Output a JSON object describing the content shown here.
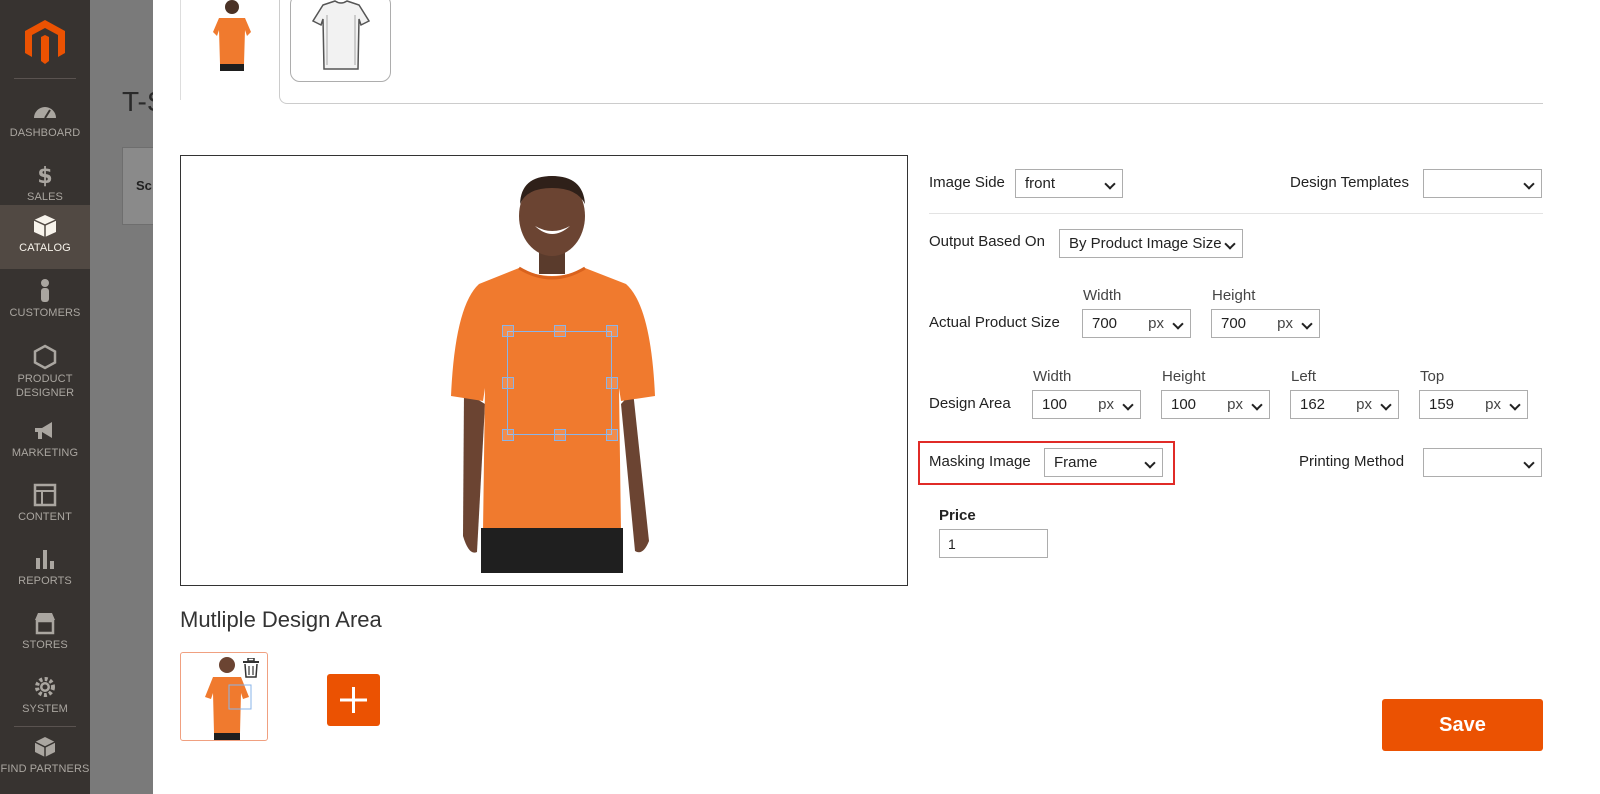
{
  "sidebar": {
    "items": [
      {
        "label": "DASHBOARD",
        "icon": "dashboard-icon"
      },
      {
        "label": "SALES",
        "icon": "dollar-icon"
      },
      {
        "label": "CATALOG",
        "icon": "box-icon",
        "active": true
      },
      {
        "label": "CUSTOMERS",
        "icon": "person-icon"
      },
      {
        "label": "PRODUCT",
        "label2": "DESIGNER",
        "icon": "hexagon-icon"
      },
      {
        "label": "MARKETING",
        "icon": "megaphone-icon"
      },
      {
        "label": "CONTENT",
        "icon": "layout-icon"
      },
      {
        "label": "REPORTS",
        "icon": "bar-chart-icon"
      },
      {
        "label": "STORES",
        "icon": "store-icon"
      },
      {
        "label": "SYSTEM",
        "icon": "gear-icon"
      },
      {
        "label": "FIND PARTNERS",
        "icon": "blocks-icon"
      }
    ]
  },
  "background": {
    "title": "T-S",
    "card_text": "Sc"
  },
  "form": {
    "image_side": {
      "label": "Image Side",
      "value": "front"
    },
    "design_templates": {
      "label": "Design Templates",
      "value": ""
    },
    "output_based_on": {
      "label": "Output Based On",
      "value": "By Product Image Size"
    },
    "actual_product_size": {
      "label": "Actual Product Size",
      "width_label": "Width",
      "width_value": "700",
      "width_unit": "px",
      "height_label": "Height",
      "height_value": "700",
      "height_unit": "px"
    },
    "design_area": {
      "label": "Design Area",
      "width_label": "Width",
      "width_value": "100",
      "width_unit": "px",
      "height_label": "Height",
      "height_value": "100",
      "height_unit": "px",
      "left_label": "Left",
      "left_value": "162",
      "left_unit": "px",
      "top_label": "Top",
      "top_value": "159",
      "top_unit": "px"
    },
    "masking_image": {
      "label": "Masking Image",
      "value": "Frame"
    },
    "printing_method": {
      "label": "Printing Method",
      "value": ""
    },
    "price": {
      "label": "Price",
      "value": "1"
    }
  },
  "multiple_design_area": {
    "title": "Mutliple Design Area"
  },
  "save_label": "Save",
  "colors": {
    "accent": "#eb5202",
    "sidebar": "#373330",
    "highlight": "#e02b27",
    "shirt": "#f07a2e"
  }
}
